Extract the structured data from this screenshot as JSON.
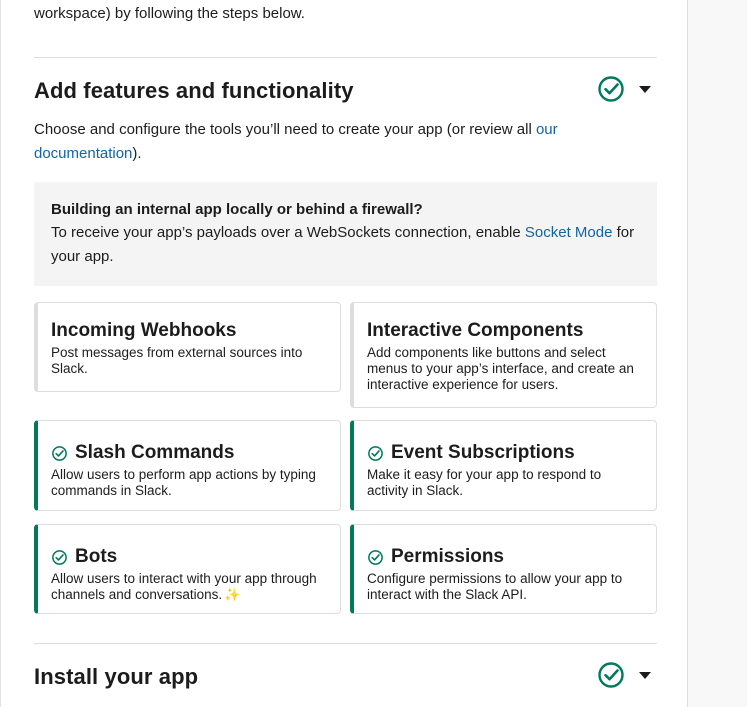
{
  "intro": {
    "tail_text": "workspace) by following the steps below."
  },
  "features_section": {
    "title": "Add features and functionality",
    "status_icon": "check-circle-icon",
    "description_prefix": "Choose and configure the tools you’ll need to create your app (or review all ",
    "description_link": "our documentation",
    "description_suffix": ").",
    "callout": {
      "title": "Building an internal app locally or behind a firewall?",
      "body_prefix": "To receive your app’s payloads over a WebSockets connection, enable ",
      "body_link": "Socket Mode",
      "body_suffix": " for your app."
    },
    "cards": [
      {
        "title": "Incoming Webhooks",
        "description": "Post messages from external sources into Slack.",
        "enabled": false
      },
      {
        "title": "Interactive Components",
        "description": "Add components like buttons and select menus to your app’s interface, and create an interactive experience for users.",
        "enabled": false
      },
      {
        "title": "Slash Commands",
        "description": "Allow users to perform app actions by typing commands in Slack.",
        "enabled": true
      },
      {
        "title": "Event Subscriptions",
        "description": "Make it easy for your app to respond to activity in Slack.",
        "enabled": true
      },
      {
        "title": "Bots",
        "description": "Allow users to interact with your app through channels and conversations.",
        "description_emoji": "✨",
        "enabled": true
      },
      {
        "title": "Permissions",
        "description": "Configure permissions to allow your app to interact with the Slack API.",
        "enabled": true
      }
    ]
  },
  "install_section": {
    "title": "Install your app",
    "status_icon": "check-circle-icon"
  },
  "colors": {
    "success_green": "#007a5a",
    "link_blue": "#1264a3",
    "callout_bg": "#f4f4f4"
  }
}
